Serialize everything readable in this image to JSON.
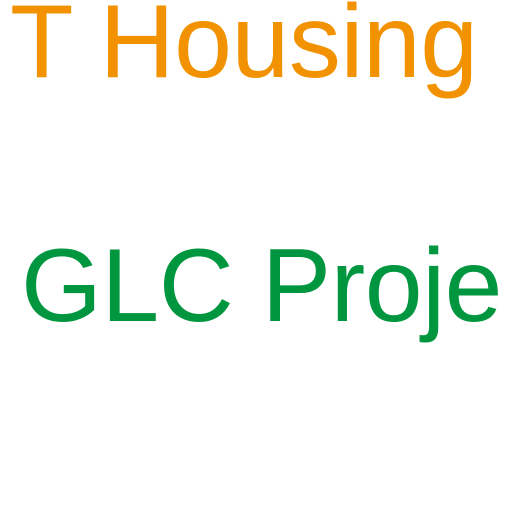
{
  "colors": {
    "background": "#ffffff",
    "line1": "#F39200",
    "line2": "#00963F"
  },
  "text": {
    "line1": "T Housing",
    "line2": "l GLC Proje"
  }
}
